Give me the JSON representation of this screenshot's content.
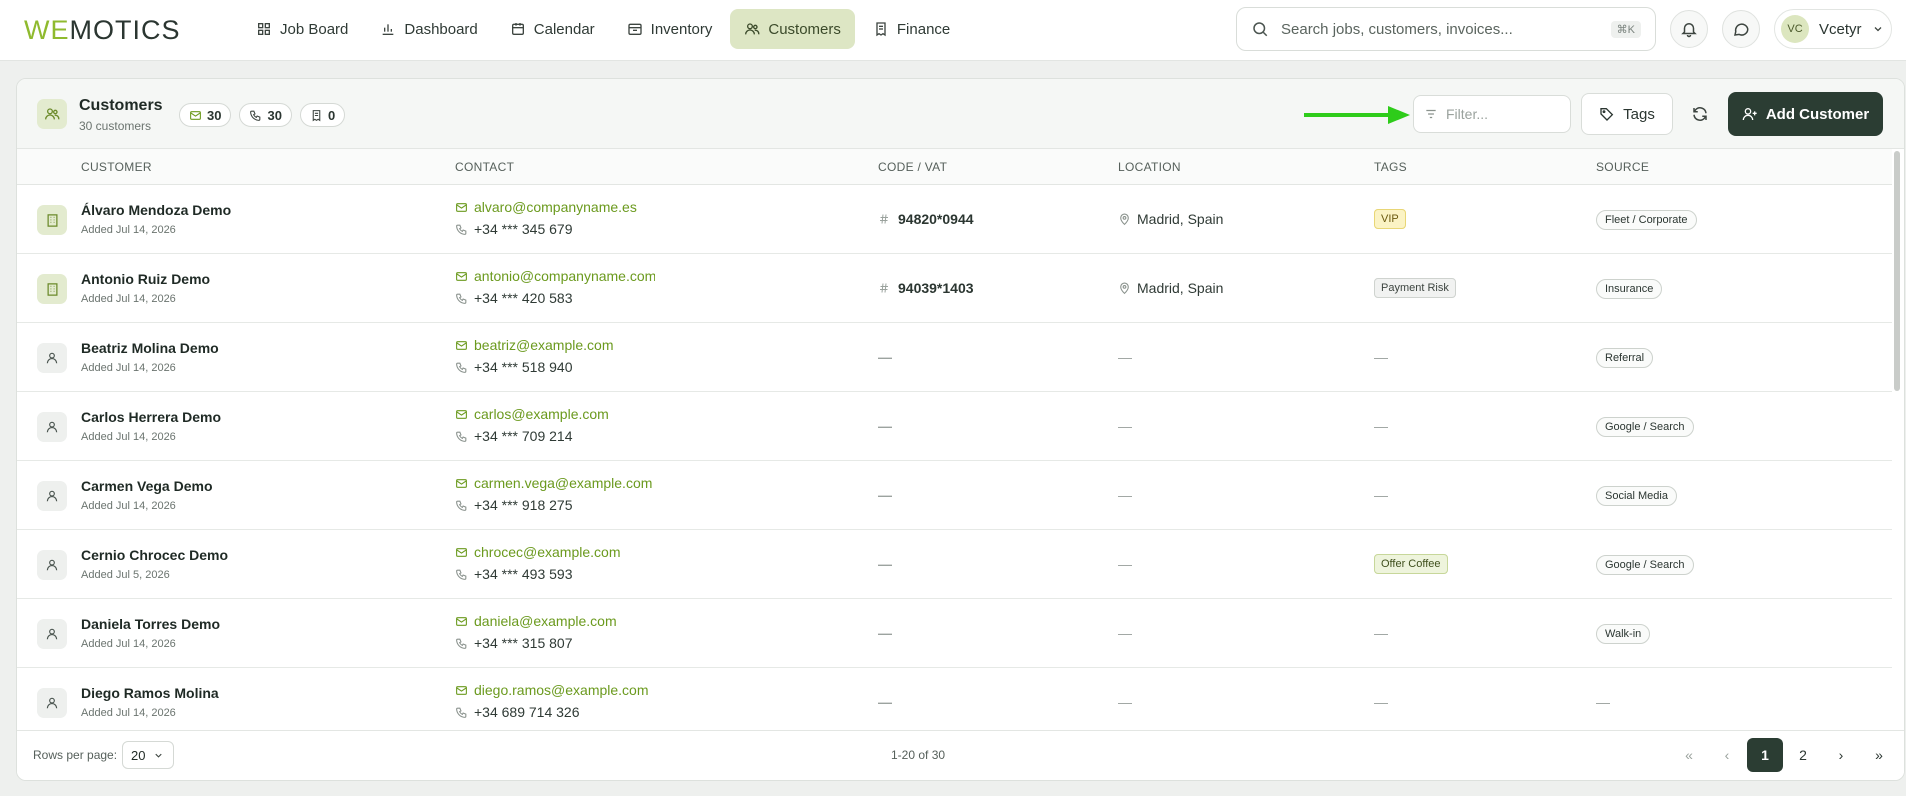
{
  "nav": {
    "logo_we": "WE",
    "logo_rest": "MOTICS",
    "tabs": [
      {
        "label": "Job Board",
        "icon": "grid-icon"
      },
      {
        "label": "Dashboard",
        "icon": "bar-chart-icon"
      },
      {
        "label": "Calendar",
        "icon": "calendar-icon"
      },
      {
        "label": "Inventory",
        "icon": "box-icon"
      },
      {
        "label": "Customers",
        "icon": "users-icon",
        "active": true
      },
      {
        "label": "Finance",
        "icon": "receipt-icon"
      }
    ],
    "search_placeholder": "Search jobs, customers, invoices...",
    "search_shortcut": "⌘K",
    "user_initials": "VC",
    "user_name": "Vcetyr"
  },
  "panel": {
    "title": "Customers",
    "subtitle": "30 customers",
    "badges": {
      "email": "30",
      "phone": "30",
      "invoice": "0"
    },
    "filter_placeholder": "Filter...",
    "tags_label": "Tags",
    "add_label": "Add Customer"
  },
  "table": {
    "headers": {
      "customer": "CUSTOMER",
      "contact": "CONTACT",
      "code": "CODE / VAT",
      "location": "LOCATION",
      "tags": "TAGS",
      "source": "SOURCE"
    },
    "rows": [
      {
        "name": "Álvaro Mendoza Demo",
        "added": "Added Jul 14, 2026",
        "email": "alvaro@companyname.es",
        "phone": "+34 *** 345 679",
        "code": "94820*0944",
        "location": "Madrid, Spain",
        "tag": "VIP",
        "tag_style": "vip",
        "source": "Fleet / Corporate",
        "type": "business"
      },
      {
        "name": "Antonio Ruiz Demo",
        "added": "Added Jul 14, 2026",
        "email": "antonio@companyname.com",
        "phone": "+34 *** 420 583",
        "code": "94039*1403",
        "location": "Madrid, Spain",
        "tag": "Payment Risk",
        "tag_style": "risk",
        "source": "Insurance",
        "type": "business"
      },
      {
        "name": "Beatriz Molina Demo",
        "added": "Added Jul 14, 2026",
        "email": "beatriz@example.com",
        "phone": "+34 *** 518 940",
        "code": "—",
        "location": "—",
        "tag": "—",
        "tag_style": "",
        "source": "Referral",
        "type": "person"
      },
      {
        "name": "Carlos Herrera Demo",
        "added": "Added Jul 14, 2026",
        "email": "carlos@example.com",
        "phone": "+34 *** 709 214",
        "code": "—",
        "location": "—",
        "tag": "—",
        "tag_style": "",
        "source": "Google / Search",
        "type": "person"
      },
      {
        "name": "Carmen Vega Demo",
        "added": "Added Jul 14, 2026",
        "email": "carmen.vega@example.com",
        "phone": "+34 *** 918 275",
        "code": "—",
        "location": "—",
        "tag": "—",
        "tag_style": "",
        "source": "Social Media",
        "type": "person"
      },
      {
        "name": "Cernio Chrocec Demo",
        "added": "Added Jul 5, 2026",
        "email": "chrocec@example.com",
        "phone": "+34 *** 493 593",
        "code": "—",
        "location": "—",
        "tag": "Offer Coffee",
        "tag_style": "coffee",
        "source": "Google / Search",
        "type": "person"
      },
      {
        "name": "Daniela Torres Demo",
        "added": "Added Jul 14, 2026",
        "email": "daniela@example.com",
        "phone": "+34 *** 315 807",
        "code": "—",
        "location": "—",
        "tag": "—",
        "tag_style": "",
        "source": "Walk-in",
        "type": "person"
      },
      {
        "name": "Diego Ramos Molina",
        "added": "Added Jul 14, 2026",
        "email": "diego.ramos@example.com",
        "phone": "+34 689 714 326",
        "code": "—",
        "location": "—",
        "tag": "—",
        "tag_style": "",
        "source": "—",
        "type": "person"
      }
    ]
  },
  "footer": {
    "rows_per_page_label": "Rows per page:",
    "rows_per_page": "20",
    "range": "1-20 of 30",
    "pages": [
      "1",
      "2"
    ],
    "current_page": "1"
  },
  "colors": {
    "accent": "#8fba2e",
    "dark": "#2b3d33",
    "arrow": "#2ecc1a"
  }
}
